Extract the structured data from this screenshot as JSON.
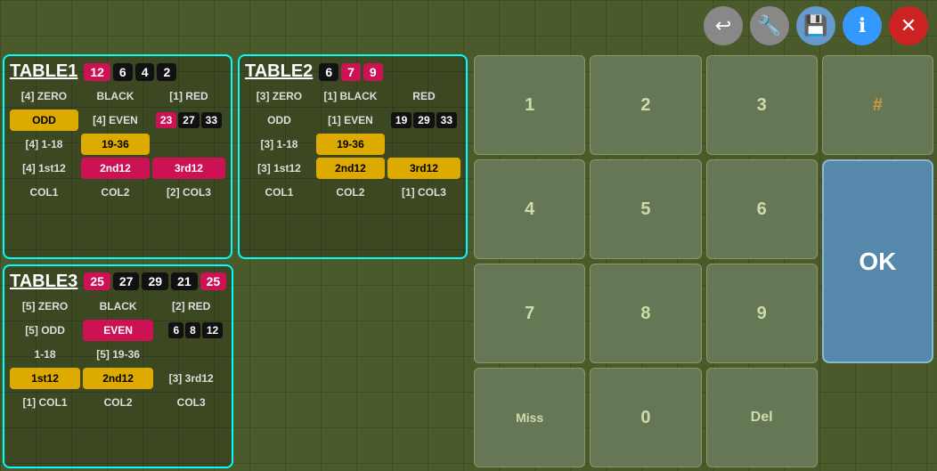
{
  "toolbar": {
    "back_label": "↩",
    "wrench_label": "🔧",
    "save_label": "💾",
    "info_label": "ℹ",
    "close_label": "✕"
  },
  "table1": {
    "title": "TABLE1",
    "header_nums": [
      {
        "value": "12",
        "color": "badge-pink"
      },
      {
        "value": "6",
        "color": "badge-black"
      },
      {
        "value": "4",
        "color": "badge-black"
      },
      {
        "value": "2",
        "color": "badge-black"
      }
    ],
    "rows": [
      {
        "cells": [
          {
            "text": "[4] ZERO",
            "style": "cell-default"
          },
          {
            "text": "BLACK",
            "style": "cell-default"
          },
          {
            "text": "[1] RED",
            "style": "cell-default"
          }
        ]
      },
      {
        "cells": [
          {
            "text": "ODD",
            "style": "cell-yellow"
          },
          {
            "text": "[4] EVEN",
            "style": "cell-default"
          },
          {
            "text": "23 27 33",
            "style": "cell-nums-pink-black-black"
          }
        ]
      },
      {
        "cells": [
          {
            "text": "[4] 1-18",
            "style": "cell-default"
          },
          {
            "text": "19-36",
            "style": "cell-yellow"
          },
          {
            "text": "",
            "style": "cell-default"
          }
        ]
      },
      {
        "cells": [
          {
            "text": "[4] 1st12",
            "style": "cell-default"
          },
          {
            "text": "2nd12",
            "style": "cell-pink"
          },
          {
            "text": "3rd12",
            "style": "cell-pink"
          }
        ]
      },
      {
        "cells": [
          {
            "text": "COL1",
            "style": "cell-default"
          },
          {
            "text": "COL2",
            "style": "cell-default"
          },
          {
            "text": "[2] COL3",
            "style": "cell-default"
          }
        ]
      }
    ]
  },
  "table2": {
    "title": "TABLE2",
    "header_nums": [
      {
        "value": "6",
        "color": "badge-black"
      },
      {
        "value": "7",
        "color": "badge-pink"
      },
      {
        "value": "9",
        "color": "badge-pink"
      }
    ],
    "rows": [
      {
        "cells": [
          {
            "text": "[3] ZERO",
            "style": "cell-default"
          },
          {
            "text": "[1] BLACK",
            "style": "cell-default"
          },
          {
            "text": "RED",
            "style": "cell-default"
          }
        ]
      },
      {
        "cells": [
          {
            "text": "ODD",
            "style": "cell-default"
          },
          {
            "text": "[1] EVEN",
            "style": "cell-default"
          },
          {
            "text": "19 29 33",
            "style": "cell-nums-black-black-black"
          }
        ]
      },
      {
        "cells": [
          {
            "text": "[3] 1-18",
            "style": "cell-default"
          },
          {
            "text": "19-36",
            "style": "cell-yellow"
          },
          {
            "text": "",
            "style": "cell-default"
          }
        ]
      },
      {
        "cells": [
          {
            "text": "[3] 1st12",
            "style": "cell-default"
          },
          {
            "text": "2nd12",
            "style": "cell-yellow"
          },
          {
            "text": "3rd12",
            "style": "cell-yellow"
          }
        ]
      },
      {
        "cells": [
          {
            "text": "COL1",
            "style": "cell-default"
          },
          {
            "text": "COL2",
            "style": "cell-default"
          },
          {
            "text": "[1] COL3",
            "style": "cell-default"
          }
        ]
      }
    ]
  },
  "table3": {
    "title": "TABLE3",
    "header_nums": [
      {
        "value": "25",
        "color": "badge-pink"
      },
      {
        "value": "27",
        "color": "badge-black"
      },
      {
        "value": "29",
        "color": "badge-black"
      },
      {
        "value": "21",
        "color": "badge-black"
      },
      {
        "value": "25",
        "color": "badge-pink"
      }
    ],
    "rows": [
      {
        "cells": [
          {
            "text": "[5] ZERO",
            "style": "cell-default"
          },
          {
            "text": "BLACK",
            "style": "cell-default"
          },
          {
            "text": "[2] RED",
            "style": "cell-default"
          }
        ]
      },
      {
        "cells": [
          {
            "text": "[5] ODD",
            "style": "cell-default"
          },
          {
            "text": "EVEN",
            "style": "cell-pink"
          },
          {
            "text": "6 8 12",
            "style": "cell-nums-black-black-black"
          }
        ]
      },
      {
        "cells": [
          {
            "text": "1-18",
            "style": "cell-default"
          },
          {
            "text": "[5] 19-36",
            "style": "cell-default"
          },
          {
            "text": "",
            "style": "cell-default"
          }
        ]
      },
      {
        "cells": [
          {
            "text": "1st12",
            "style": "cell-yellow"
          },
          {
            "text": "2nd12",
            "style": "cell-yellow"
          },
          {
            "text": "[3] 3rd12",
            "style": "cell-default"
          }
        ]
      },
      {
        "cells": [
          {
            "text": "[1] COL1",
            "style": "cell-default"
          },
          {
            "text": "COL2",
            "style": "cell-default"
          },
          {
            "text": "COL3",
            "style": "cell-default"
          }
        ]
      }
    ]
  },
  "numpad": {
    "keys": [
      {
        "label": "1",
        "type": "num"
      },
      {
        "label": "2",
        "type": "num"
      },
      {
        "label": "3",
        "type": "num"
      },
      {
        "label": "#",
        "type": "hash"
      },
      {
        "label": "4",
        "type": "num"
      },
      {
        "label": "5",
        "type": "num"
      },
      {
        "label": "6",
        "type": "num"
      },
      {
        "label": "OK",
        "type": "ok"
      },
      {
        "label": "7",
        "type": "num"
      },
      {
        "label": "8",
        "type": "num"
      },
      {
        "label": "9",
        "type": "num"
      },
      {
        "label": "Miss",
        "type": "miss"
      },
      {
        "label": "0",
        "type": "num"
      },
      {
        "label": "Del",
        "type": "del"
      }
    ]
  }
}
